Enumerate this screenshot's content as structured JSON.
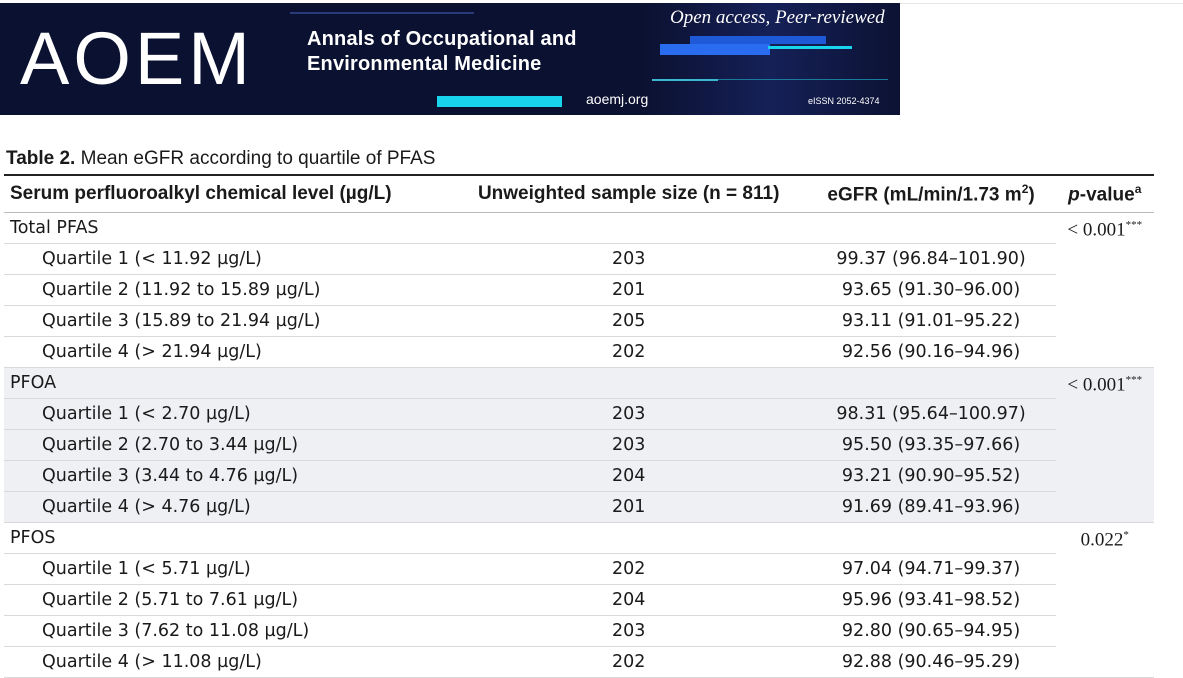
{
  "banner": {
    "logo": "AOEM",
    "journal_line1": "Annals of Occupational and",
    "journal_line2": "Environmental Medicine",
    "tagline": "Open access, Peer-reviewed",
    "url": "aoemj.org",
    "issn": "eISSN 2052-4374",
    "colors": {
      "background": "#0b1130",
      "accent": "#18d4ec"
    }
  },
  "caption": {
    "label": "Table 2.",
    "text": " Mean eGFR according to quartile of PFAS"
  },
  "table": {
    "headers": {
      "col1": "Serum perfluoroalkyl chemical level (µg/L)",
      "col2": "Unweighted sample size (n = 811)",
      "col3": "eGFR (mL/min/1.73 m",
      "col3_sup": "2",
      "col3_tail": ")",
      "col4_p": "p",
      "col4": "-value",
      "col4_sup": "a"
    },
    "groups": [
      {
        "name": "Total PFAS",
        "p": "< 0.001",
        "p_sup": "***",
        "rows": [
          {
            "label": "Quartile 1 (< 11.92 µg/L)",
            "n": "203",
            "egfr": "99.37 (96.84–101.90)"
          },
          {
            "label": "Quartile 2 (11.92 to 15.89 µg/L)",
            "n": "201",
            "egfr": "93.65 (91.30–96.00)"
          },
          {
            "label": "Quartile 3 (15.89 to 21.94 µg/L)",
            "n": "205",
            "egfr": "93.11 (91.01–95.22)"
          },
          {
            "label": "Quartile 4 (> 21.94 µg/L)",
            "n": "202",
            "egfr": "92.56 (90.16–94.96)"
          }
        ]
      },
      {
        "name": "PFOA",
        "p": "< 0.001",
        "p_sup": "***",
        "rows": [
          {
            "label": "Quartile 1 (< 2.70 µg/L)",
            "n": "203",
            "egfr": "98.31 (95.64–100.97)"
          },
          {
            "label": "Quartile 2 (2.70 to 3.44 µg/L)",
            "n": "203",
            "egfr": "95.50 (93.35–97.66)"
          },
          {
            "label": "Quartile 3 (3.44 to 4.76 µg/L)",
            "n": "204",
            "egfr": "93.21 (90.90–95.52)"
          },
          {
            "label": "Quartile 4 (> 4.76 µg/L)",
            "n": "201",
            "egfr": "91.69 (89.41–93.96)"
          }
        ]
      },
      {
        "name": "PFOS",
        "p": "0.022",
        "p_sup": "*",
        "rows": [
          {
            "label": "Quartile 1 (< 5.71 µg/L)",
            "n": "202",
            "egfr": "97.04 (94.71–99.37)"
          },
          {
            "label": "Quartile 2 (5.71 to 7.61 µg/L)",
            "n": "204",
            "egfr": "95.96 (93.41–98.52)"
          },
          {
            "label": "Quartile 3 (7.62 to 11.08 µg/L)",
            "n": "203",
            "egfr": "92.80 (90.65–94.95)"
          },
          {
            "label": "Quartile 4 (> 11.08 µg/L)",
            "n": "202",
            "egfr": "92.88 (90.46–95.29)"
          }
        ]
      }
    ]
  }
}
